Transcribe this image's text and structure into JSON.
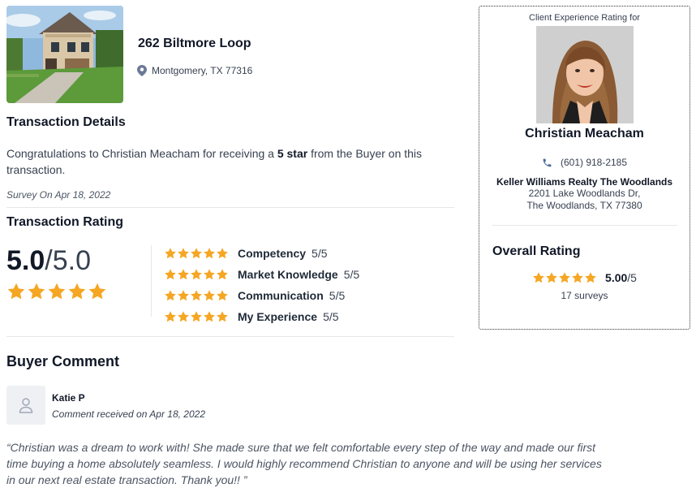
{
  "property": {
    "address": "262 Biltmore Loop",
    "location": "Montgomery, TX 77316",
    "location_icon": "map-pin-icon"
  },
  "transaction_details": {
    "heading": "Transaction Details",
    "congrats_prefix": "Congratulations to Christian Meacham for receiving a ",
    "congrats_bold": "5 star",
    "congrats_suffix": " from the Buyer on this transaction.",
    "survey_date": "Survey On Apr 18, 2022"
  },
  "transaction_rating": {
    "heading": "Transaction Rating",
    "score": "5.0",
    "score_max": "/5.0",
    "stars": 5,
    "categories": [
      {
        "label": "Competency",
        "score": "5/5",
        "stars": 5
      },
      {
        "label": "Market Knowledge",
        "score": "5/5",
        "stars": 5
      },
      {
        "label": "Communication",
        "score": "5/5",
        "stars": 5
      },
      {
        "label": "My Experience",
        "score": "5/5",
        "stars": 5
      }
    ]
  },
  "buyer_comment": {
    "heading": "Buyer Comment",
    "reviewer": "Katie P",
    "date": "Comment received on Apr 18, 2022",
    "text": "“Christian was a dream to work with! She made sure that we felt comfortable every step of the way and made our first time buying a home absolutely seamless. I would highly recommend Christian to anyone and will be using her services in our next real estate transaction. Thank you!! ”"
  },
  "agent": {
    "caption": "Client Experience Rating for",
    "name": "Christian Meacham",
    "phone": "(601) 918-2185",
    "phone_icon": "phone-icon",
    "brokerage": "Keller Williams Realty The Woodlands",
    "address_line1": "2201 Lake Woodlands Dr,",
    "address_line2": "The Woodlands, TX 77380",
    "overall_heading": "Overall Rating",
    "overall_score": "5.00",
    "overall_max": "/5",
    "overall_stars": 5,
    "survey_count": "17 surveys"
  },
  "colors": {
    "star": "#f5a623",
    "text_dark": "#111827",
    "text_muted": "#374151",
    "divider": "#e5e7eb",
    "pin_icon": "#6b7280",
    "phone_icon": "#4b6a9b"
  }
}
